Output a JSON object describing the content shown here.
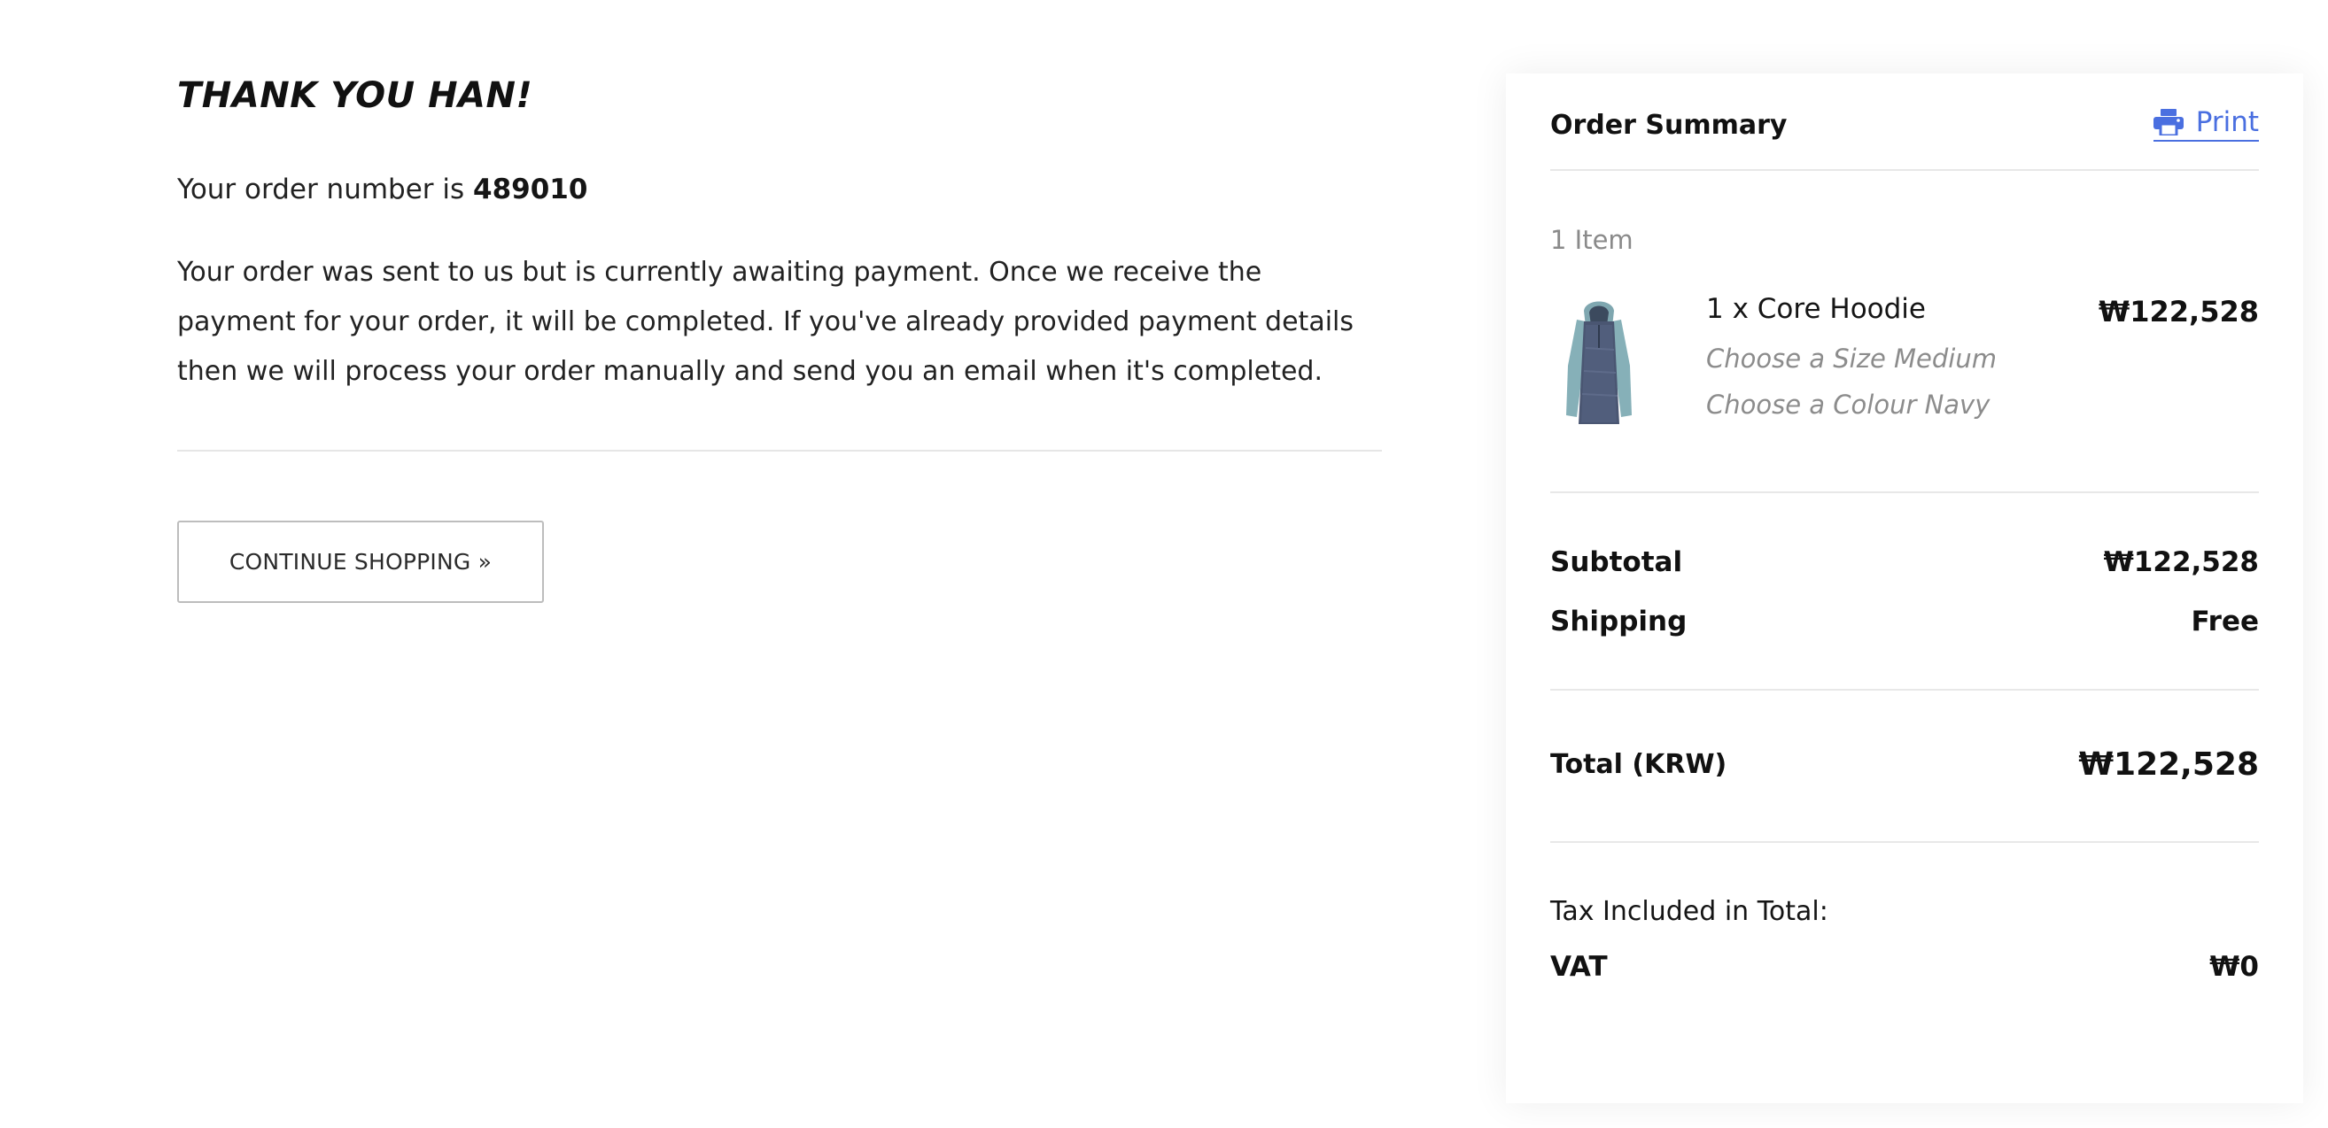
{
  "confirmation": {
    "heading": "THANK YOU HAN!",
    "order_prefix": "Your order number is ",
    "order_number": "489010",
    "message": "Your order was sent to us but is currently awaiting payment. Once we receive the payment for your order, it will be completed. If you've already provided payment details then we will process your order manually and send you an email when it's completed.",
    "continue_label": "CONTINUE SHOPPING »"
  },
  "summary": {
    "title": "Order Summary",
    "print_label": "Print",
    "print_icon": "printer-icon",
    "item_count": "1 Item",
    "items": [
      {
        "name": "1 x Core Hoodie",
        "image": "hoodie-thumbnail",
        "options": [
          "Choose a Size Medium",
          "Choose a Colour Navy"
        ],
        "price": "₩122,528"
      }
    ],
    "subtotal_label": "Subtotal",
    "subtotal_value": "₩122,528",
    "shipping_label": "Shipping",
    "shipping_value": "Free",
    "total_label": "Total (KRW)",
    "total_value": "₩122,528",
    "tax_heading": "Tax Included in Total:",
    "vat_label": "VAT",
    "vat_value": "₩0"
  },
  "colors": {
    "link": "#4a6fe0",
    "text": "#1c1c1c",
    "muted": "#8a8a8a",
    "divider": "#e8e8e8"
  }
}
